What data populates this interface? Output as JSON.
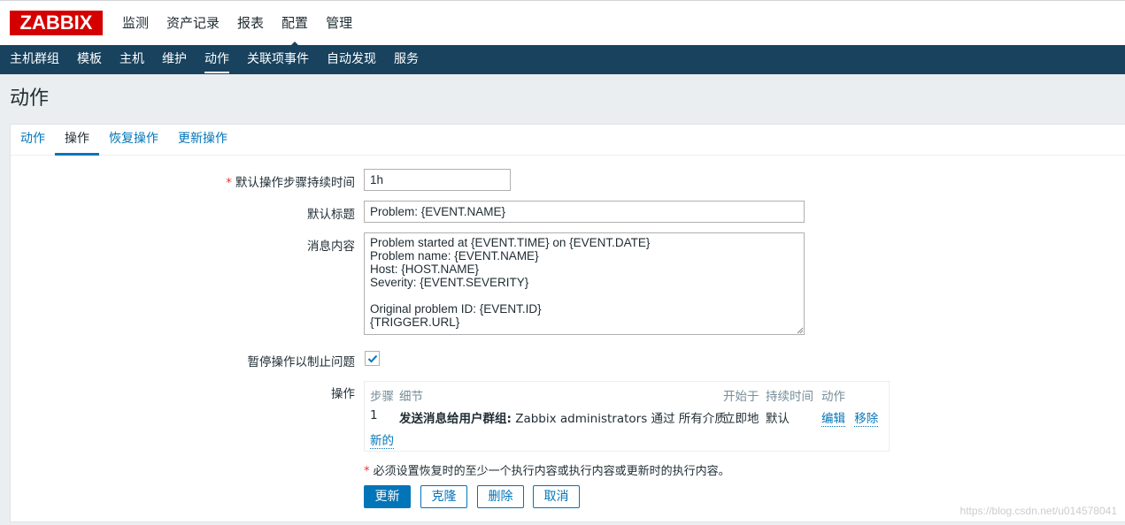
{
  "header": {
    "logo": "ZABBIX",
    "main_nav": [
      "监测",
      "资产记录",
      "报表",
      "配置",
      "管理"
    ],
    "main_nav_active": 3
  },
  "subnav": {
    "items": [
      "主机群组",
      "模板",
      "主机",
      "维护",
      "动作",
      "关联项事件",
      "自动发现",
      "服务"
    ],
    "active": 4
  },
  "page": {
    "title": "动作"
  },
  "tabs": {
    "items": [
      "动作",
      "操作",
      "恢复操作",
      "更新操作"
    ],
    "active": 1
  },
  "form": {
    "duration_label": "默认操作步骤持续时间",
    "duration_value": "1h",
    "subject_label": "默认标题",
    "subject_value": "Problem: {EVENT.NAME}",
    "message_label": "消息内容",
    "message_value": "Problem started at {EVENT.TIME} on {EVENT.DATE}\nProblem name: {EVENT.NAME}\nHost: {HOST.NAME}\nSeverity: {EVENT.SEVERITY}\n\nOriginal problem ID: {EVENT.ID}\n{TRIGGER.URL}",
    "pause_label": "暂停操作以制止问题",
    "pause_checked": true,
    "operations_label": "操作"
  },
  "operations": {
    "headers": {
      "step": "步骤",
      "details": "细节",
      "start_in": "开始于",
      "duration": "持续时间",
      "action": "动作"
    },
    "rows": [
      {
        "step": "1",
        "details_bold": "发送消息给用户群组:",
        "details_rest": " Zabbix administrators 通过 所有介质",
        "start_in": "立即地",
        "duration": "默认",
        "edit": "编辑",
        "remove": "移除"
      }
    ],
    "new_link": "新的"
  },
  "note": {
    "asterisk": "*",
    "text": " 必须设置恢复时的至少一个执行内容或执行内容或更新时的执行内容。"
  },
  "buttons": {
    "update": "更新",
    "clone": "克隆",
    "delete": "删除",
    "cancel": "取消"
  },
  "watermark": "https://blog.csdn.net/u014578041"
}
